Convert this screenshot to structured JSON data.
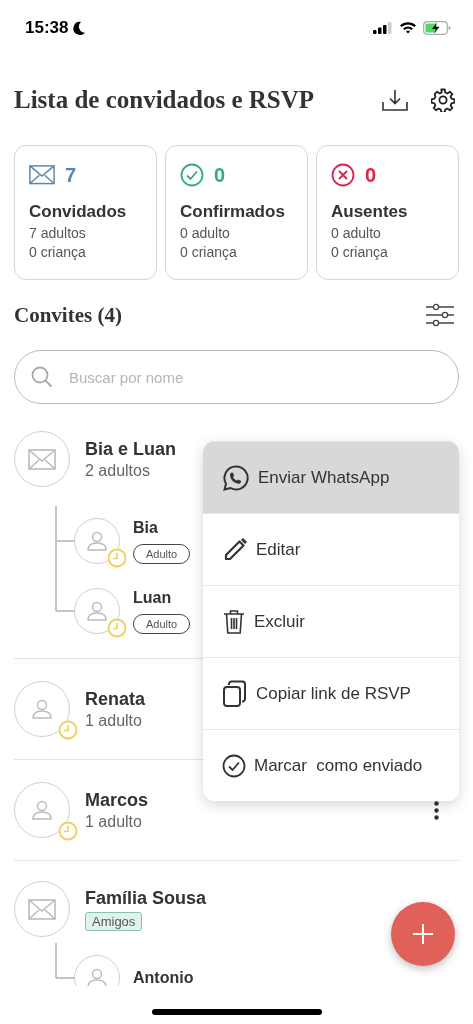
{
  "status_bar": {
    "time": "15:38"
  },
  "header": {
    "title": "Lista de convidados e RSVP"
  },
  "stats": [
    {
      "kind": "invited",
      "count": "7",
      "label": "Convidados",
      "adults": "7 adultos",
      "children": "0 criança",
      "color": "#5b86a8"
    },
    {
      "kind": "confirmed",
      "count": "0",
      "label": "Confirmados",
      "adults": "0 adulto",
      "children": "0 criança",
      "color": "#2fae7b"
    },
    {
      "kind": "absent",
      "count": "0",
      "label": "Ausentes",
      "adults": "0 adulto",
      "children": "0 criança",
      "color": "#d9264a"
    }
  ],
  "invites_header": {
    "title": "Convites (4)"
  },
  "search": {
    "placeholder": "Buscar por nome"
  },
  "invites": [
    {
      "kind": "group",
      "name": "Bia e Luan",
      "subtitle": "2 adultos",
      "more_button": false,
      "members": [
        {
          "name": "Bia",
          "tag": "Adulto",
          "pending": true
        },
        {
          "name": "Luan",
          "tag": "Adulto",
          "pending": true
        }
      ]
    },
    {
      "kind": "single",
      "name": "Renata",
      "subtitle": "1 adulto",
      "pending": true,
      "more_button": false
    },
    {
      "kind": "single",
      "name": "Marcos",
      "subtitle": "1 adulto",
      "pending": true,
      "more_button": true
    },
    {
      "kind": "group",
      "name": "Família Sousa",
      "tag": "Amigos",
      "more_button": false,
      "members": [
        {
          "name": "Antonio",
          "pending": false
        }
      ]
    }
  ],
  "context_menu": {
    "items": [
      {
        "kind": "whatsapp",
        "label": "Enviar WhatsApp",
        "selected": true
      },
      {
        "kind": "edit",
        "label": "Editar",
        "selected": false
      },
      {
        "kind": "delete",
        "label": "Excluir",
        "selected": false
      },
      {
        "kind": "copy",
        "label": "Copiar link de RSVP",
        "selected": false
      },
      {
        "kind": "sent",
        "label": "Marcar  como enviado",
        "selected": false
      }
    ]
  }
}
